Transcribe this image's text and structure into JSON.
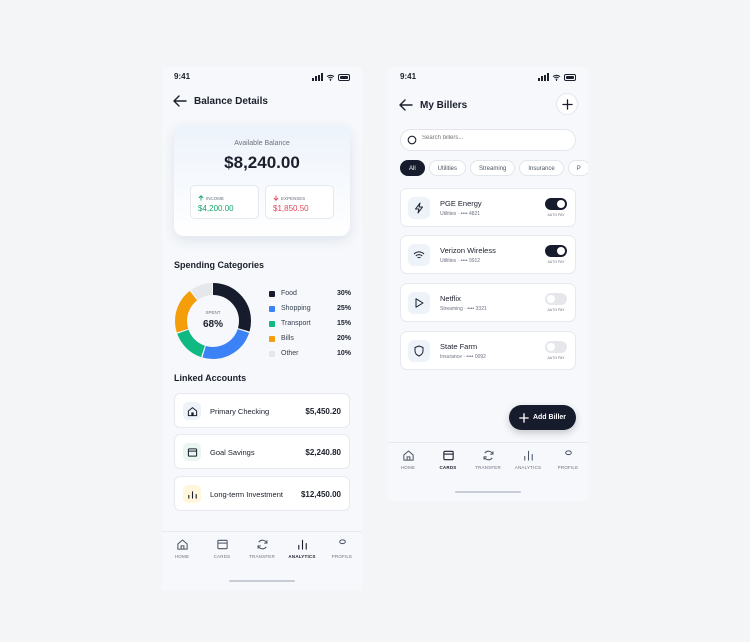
{
  "status_bar": {
    "time": "9:41"
  },
  "balance_screen": {
    "title": "Balance Details",
    "balance": {
      "label": "Available Balance",
      "amount": "$8,240.00"
    },
    "income": {
      "label": "INCOME",
      "value": "$4,200.00"
    },
    "expenses": {
      "label": "EXPENSES",
      "value": "$1,850.50"
    },
    "spending_title": "Spending Categories",
    "donut": {
      "center_label": "SPENT",
      "center_value": "68%"
    },
    "categories": [
      {
        "name": "Food",
        "pct": "30%",
        "color": "#161c2c",
        "value": 30
      },
      {
        "name": "Shopping",
        "pct": "25%",
        "color": "#3b82f6",
        "value": 25
      },
      {
        "name": "Transport",
        "pct": "15%",
        "color": "#10b981",
        "value": 15
      },
      {
        "name": "Bills",
        "pct": "20%",
        "color": "#f59e0b",
        "value": 20
      },
      {
        "name": "Other",
        "pct": "10%",
        "color": "#e5e7eb",
        "value": 10
      }
    ],
    "accounts_title": "Linked Accounts",
    "accounts": [
      {
        "name": "Primary Checking",
        "value": "$5,450.20",
        "icon": "bank-icon"
      },
      {
        "name": "Goal Savings",
        "value": "$2,240.80",
        "icon": "wallet-icon"
      },
      {
        "name": "Long-term Investment",
        "value": "$12,450.00",
        "icon": "chart-icon"
      }
    ],
    "active_tab": "ANALYTICS"
  },
  "billers_screen": {
    "title": "My Billers",
    "search_placeholder": "Search billers...",
    "filters": [
      "All",
      "Utilities",
      "Streaming",
      "Insurance",
      "P"
    ],
    "billers": [
      {
        "name": "PGE Energy",
        "category": "Utilities",
        "account": "•••• 4821",
        "autopay": true,
        "icon": "lightning-icon"
      },
      {
        "name": "Verizon Wireless",
        "category": "Utilities",
        "account": "•••• 9912",
        "autopay": true,
        "icon": "wifi-icon"
      },
      {
        "name": "Netflix",
        "category": "Streaming",
        "account": "•••• 3321",
        "autopay": false,
        "icon": "play-icon"
      },
      {
        "name": "State Farm",
        "category": "Insurance",
        "account": "•••• 0092",
        "autopay": false,
        "icon": "shield-icon"
      }
    ],
    "autopay_label": "AUTO PAY",
    "add_button": "Add Biller",
    "active_tab": "CARDS"
  },
  "tabs": [
    "HOME",
    "CARDS",
    "TRANSFER",
    "ANALYTICS",
    "PROFILE"
  ],
  "colors": {
    "income": "#16a36a",
    "expense": "#e0475b",
    "primary": "#161c2c"
  }
}
